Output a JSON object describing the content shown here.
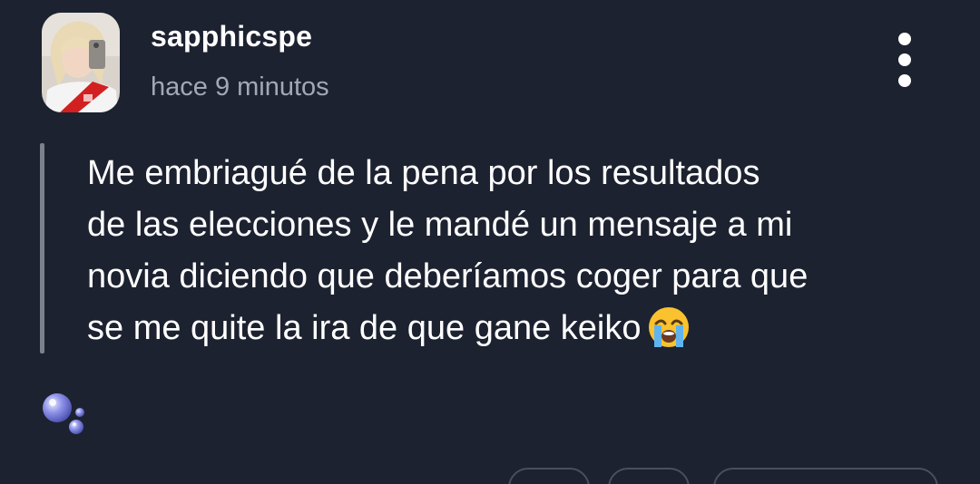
{
  "post": {
    "username": "sapphicspe",
    "timestamp": "hace 9 minutos",
    "text_lines": [
      "Me embriagué de la pena por los resultados",
      "de las elecciones y le mandé un mensaje a mi",
      "novia diciendo que deberíamos coger para que",
      "se me quite la ira de que gane keiko"
    ],
    "trailing_emoji": "loudly-crying-face"
  },
  "icons": {
    "more": "vertical-dots-icon",
    "reaction": "bubbles-icon"
  },
  "colors": {
    "background": "#1d2230",
    "text": "#ffffff",
    "muted": "#a4a8b4",
    "quote_bar": "#7d818c"
  }
}
